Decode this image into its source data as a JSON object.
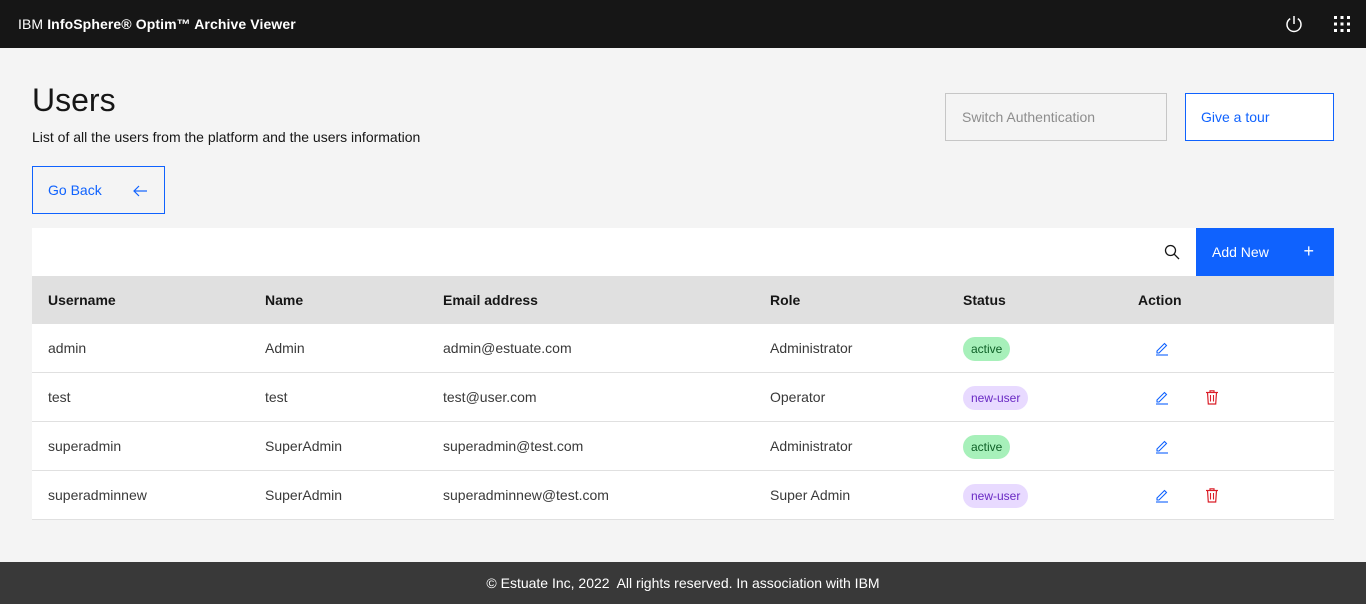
{
  "header": {
    "brand_prefix": "IBM ",
    "brand_name": "InfoSphere® Optim™ Archive Viewer",
    "icons": [
      "power-icon",
      "app-switcher-icon"
    ]
  },
  "page": {
    "title": "Users",
    "subtitle": "List of all the users from the platform and the users information"
  },
  "buttons": {
    "switch_auth": "Switch Authentication",
    "tour": "Give a tour",
    "back": "Go Back",
    "add_new": "Add New"
  },
  "table": {
    "columns": [
      "Username",
      "Name",
      "Email address",
      "Role",
      "Status",
      "Action"
    ],
    "rows": [
      {
        "username": "admin",
        "name": "Admin",
        "email": "admin@estuate.com",
        "role": "Administrator",
        "status": "active",
        "deletable": false
      },
      {
        "username": "test",
        "name": "test",
        "email": "test@user.com",
        "role": "Operator",
        "status": "new-user",
        "deletable": true
      },
      {
        "username": "superadmin",
        "name": "SuperAdmin",
        "email": "superadmin@test.com",
        "role": "Administrator",
        "status": "active",
        "deletable": false
      },
      {
        "username": "superadminnew",
        "name": "SuperAdmin",
        "email": "superadminnew@test.com",
        "role": "Super Admin",
        "status": "new-user",
        "deletable": true
      }
    ]
  },
  "footer": {
    "text": "© Estuate Inc, 2022  All rights reserved. In association with IBM"
  },
  "colors": {
    "primary": "#0f62fe",
    "topbar": "#161616",
    "footer": "#393939",
    "status_active_bg": "#a7f0ba",
    "status_new_bg": "#e8daff",
    "delete": "#da1e28"
  }
}
